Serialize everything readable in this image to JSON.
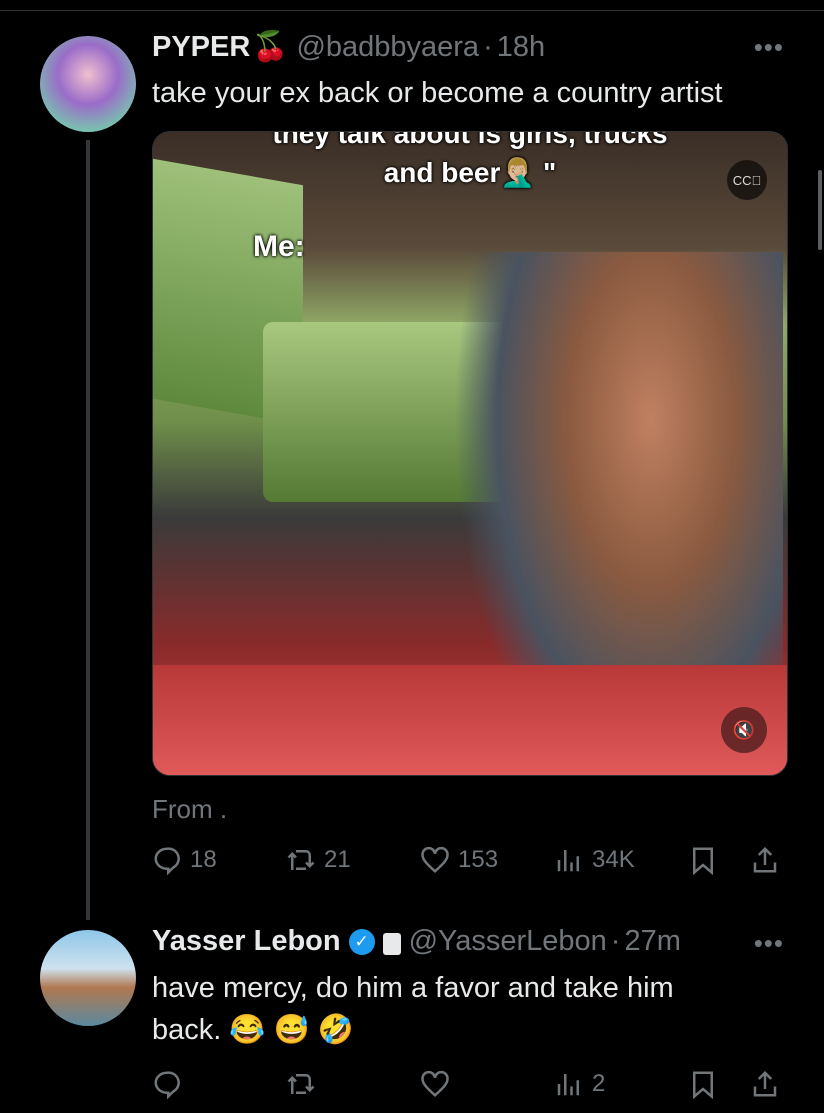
{
  "tweets": [
    {
      "name": "PYPER",
      "name_emoji": "🍒",
      "handle": "@badbbyaera",
      "time": "18h",
      "text": "take your ex back or become a country artist",
      "media": {
        "caption_top": "they talk about is girls, trucks",
        "caption_line2": "and beer🤦🏼‍♂️ \"",
        "overlay_label": "Me:",
        "cc_icon": "captions-off-icon",
        "mute_icon": "speaker-muted-icon"
      },
      "from": "From .",
      "stats": {
        "replies": "18",
        "reposts": "21",
        "likes": "153",
        "views": "34K"
      }
    },
    {
      "name": "Yasser Lebon",
      "verified": true,
      "protected": true,
      "handle": "@YasserLebon",
      "time": "27m",
      "text_line1": "have mercy, do him a favor and take him",
      "text_line2": "back. 😂 😅 🤣",
      "stats": {
        "replies": "",
        "reposts": "",
        "likes": "",
        "views": "2"
      }
    }
  ],
  "colors": {
    "background": "#000000",
    "muted": "#71767b",
    "verified": "#1d9bf0"
  }
}
